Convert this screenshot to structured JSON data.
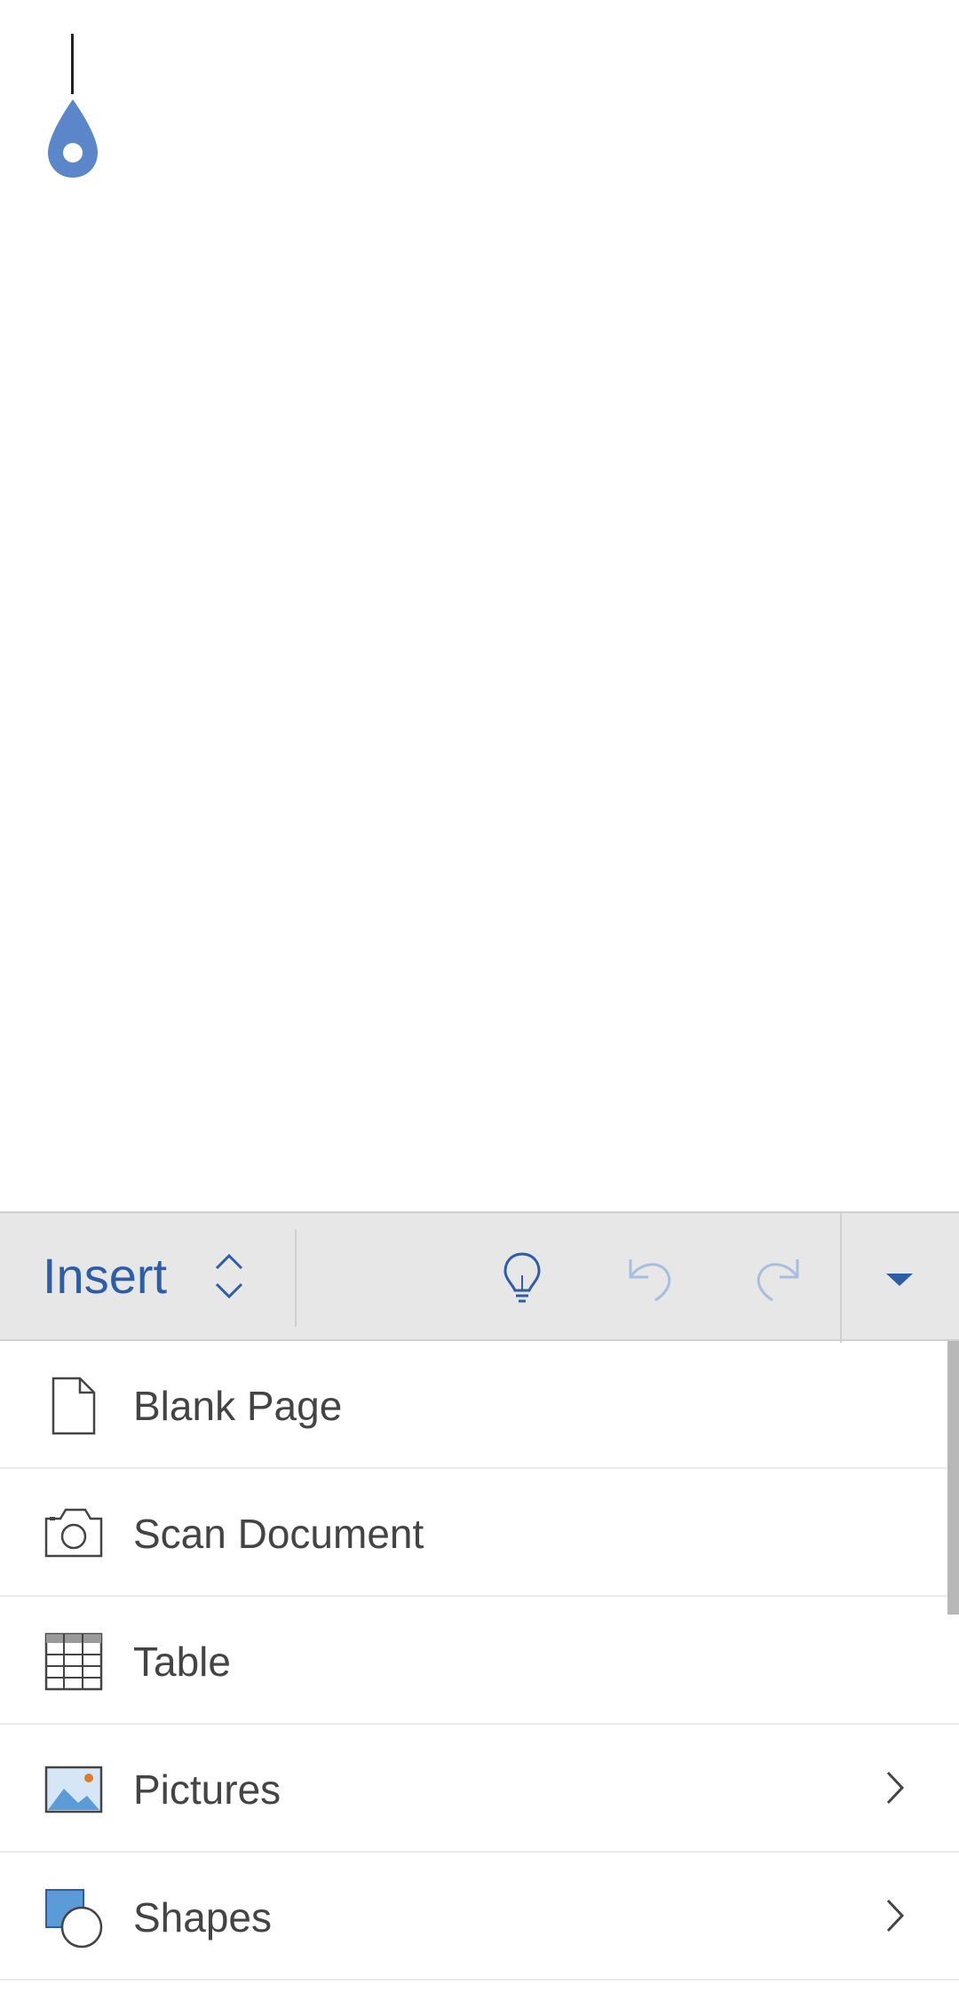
{
  "toolbar": {
    "active_tab": "Insert",
    "tab_switcher_icon": "chevron-up-down-icon",
    "ideas_icon": "lightbulb-icon",
    "undo_icon": "undo-icon",
    "redo_icon": "redo-icon",
    "collapse_icon": "caret-down-icon"
  },
  "menu": {
    "items": [
      {
        "label": "Blank Page",
        "icon": "blank-page-icon",
        "has_submenu": false
      },
      {
        "label": "Scan Document",
        "icon": "camera-icon",
        "has_submenu": false
      },
      {
        "label": "Table",
        "icon": "table-icon",
        "has_submenu": false
      },
      {
        "label": "Pictures",
        "icon": "picture-icon",
        "has_submenu": true
      },
      {
        "label": "Shapes",
        "icon": "shapes-icon",
        "has_submenu": true
      }
    ]
  },
  "colors": {
    "accent": "#2e5da8",
    "cursor_handle": "#5b86c9",
    "toolbar_bg": "#e7e7e7",
    "disabled_icon": "#a7bedf"
  }
}
